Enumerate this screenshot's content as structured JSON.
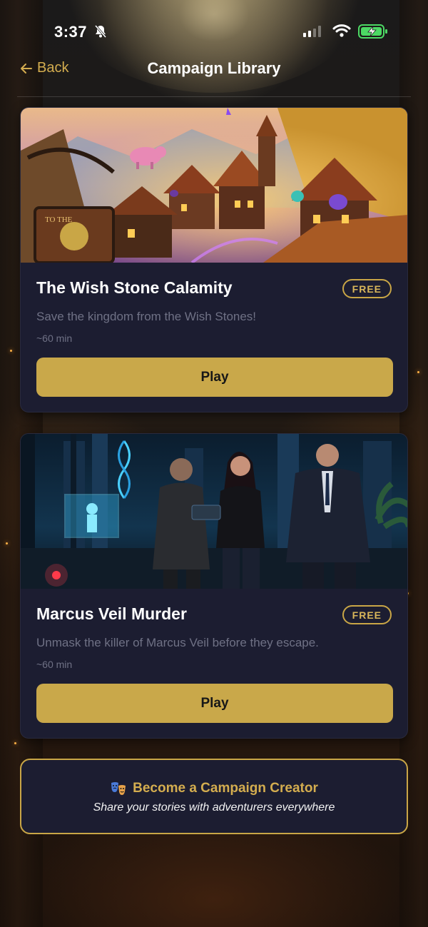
{
  "status_bar": {
    "time": "3:37",
    "icons": [
      "bell-slash-icon",
      "signal-icon",
      "wifi-icon",
      "battery-charging-icon"
    ]
  },
  "header": {
    "back_label": "Back",
    "title": "Campaign Library"
  },
  "campaigns": [
    {
      "title": "The Wish Stone Calamity",
      "badge": "FREE",
      "description": "Save the kingdom from the Wish Stones!",
      "duration": "~60 min",
      "play_label": "Play"
    },
    {
      "title": "Marcus Veil Murder",
      "badge": "FREE",
      "description": "Unmask the killer of Marcus Veil before they escape.",
      "duration": "~60 min",
      "play_label": "Play"
    }
  ],
  "creator_banner": {
    "icon": "theater-masks-icon",
    "title": "Become a Campaign Creator",
    "subtitle": "Share your stories with adventurers everywhere"
  },
  "colors": {
    "accent_gold": "#c9a84a",
    "card_bg": "#1c1d31",
    "muted_text": "#6f7185"
  }
}
